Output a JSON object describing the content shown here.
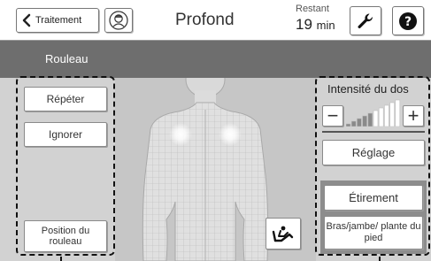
{
  "header": {
    "back_label": "Traitement",
    "title": "Profond",
    "remaining_label": "Restant",
    "remaining_value": "19",
    "remaining_unit": "min"
  },
  "band": {
    "label": "Rouleau"
  },
  "left_panel": {
    "repeat_label": "Répéter",
    "ignore_label": "Ignorer",
    "roller_position_label": "Position du rouleau"
  },
  "right_panel": {
    "intensity_title": "Intensité du dos",
    "minus_label": "−",
    "plus_label": "+",
    "intensity_level": 0.5,
    "adjust_label": "Réglage",
    "stretch_label": "Étirement",
    "body_parts_label": "Bras/jambe/ plante du pied"
  },
  "icons": [
    "chevron-left-icon",
    "user-face-icon",
    "wrench-icon",
    "help-icon",
    "recline-icon"
  ],
  "colors": {
    "band": "#6e6e6e",
    "panel_bg": "#d2d2d2",
    "figure_bg": "#c6c6c6",
    "stretch_group_bg": "#8d8d8d"
  }
}
